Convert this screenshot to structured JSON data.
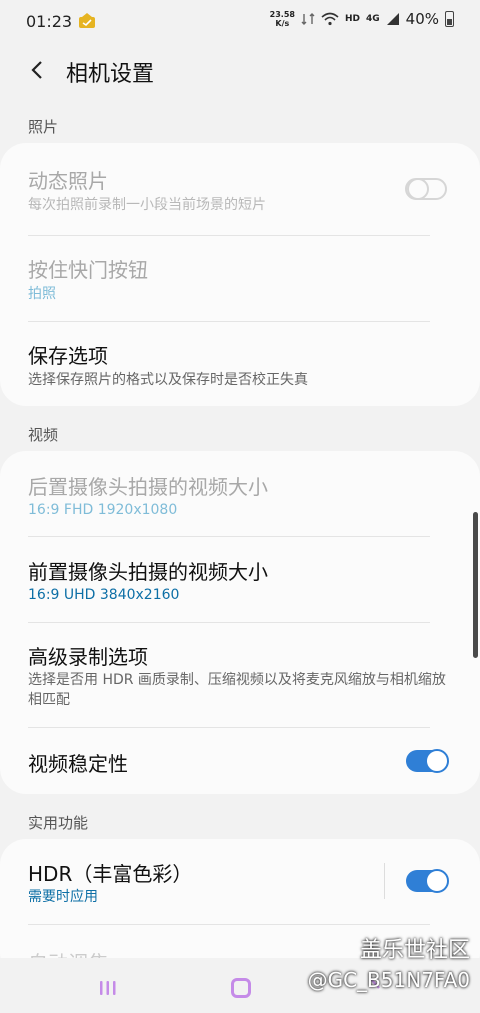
{
  "status_bar": {
    "time": "01:23",
    "speed_top": "23.58",
    "speed_bottom": "K/s",
    "hd": "HD",
    "lte": "4G",
    "battery": "40%"
  },
  "header": {
    "title": "相机设置"
  },
  "sections": {
    "photo": {
      "label": "照片",
      "motion_photo": {
        "title": "动态照片",
        "subtitle": "每次拍照前录制一小段当前场景的短片",
        "enabled": false
      },
      "hold_shutter": {
        "title": "按住快门按钮",
        "value": "拍照"
      },
      "save_options": {
        "title": "保存选项",
        "subtitle": "选择保存照片的格式以及保存时是否校正失真"
      }
    },
    "video": {
      "label": "视频",
      "rear_video_size": {
        "title": "后置摄像头拍摄的视频大小",
        "value": "16:9 FHD 1920x1080"
      },
      "front_video_size": {
        "title": "前置摄像头拍摄的视频大小",
        "value": "16:9 UHD 3840x2160"
      },
      "advanced_recording": {
        "title": "高级录制选项",
        "subtitle": "选择是否用 HDR 画质录制、压缩视频以及将麦克风缩放与相机缩放相匹配"
      },
      "stabilization": {
        "title": "视频稳定性",
        "enabled": true
      }
    },
    "useful": {
      "label": "实用功能",
      "hdr": {
        "title": "HDR（丰富色彩）",
        "value": "需要时应用",
        "enabled": true
      },
      "next_item": {
        "title": "自动调焦"
      }
    }
  },
  "watermark": {
    "line1": "盖乐世社区",
    "line2": "@GC_B51N7FA0"
  },
  "colors": {
    "accent": "#2f7fd6",
    "value_blue": "#0d6fa6",
    "background": "#f2f2f2",
    "card": "#fbfbfb"
  }
}
